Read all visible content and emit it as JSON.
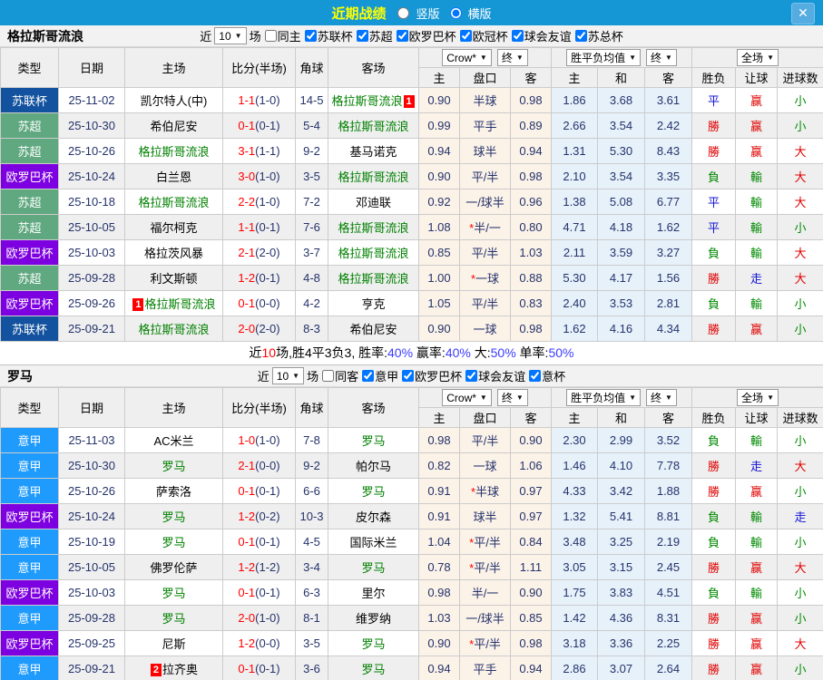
{
  "titlebar": {
    "title": "近期战绩",
    "radio_vertical": "竖版",
    "radio_horizontal": "横版",
    "selected": "横版",
    "close": "✕"
  },
  "colors": {
    "bar": "#1697d5",
    "league": {
      "苏联杯": "#13529e",
      "苏超": "#5fa880",
      "欧罗巴杯": "#7d00e0",
      "意甲": "#1e9bfc"
    },
    "result": {
      "r": "#e00000",
      "g": "#018a01",
      "b": "#1414d4"
    },
    "score": "#ff0000",
    "half": "#25336b",
    "team_highlight": "#008000",
    "badge": "#ff0000"
  },
  "table_header": {
    "type": "类型",
    "date": "日期",
    "home": "主场",
    "score": "比分(半场)",
    "corner": "角球",
    "away": "客场",
    "sub": [
      "主",
      "盘口",
      "客",
      "主",
      "和",
      "客",
      "胜负",
      "让球",
      "进球数"
    ],
    "dropdowns": {
      "company": "Crow*",
      "final1": "终",
      "avg": "胜平负均值",
      "final2": "终",
      "scope": "全场"
    }
  },
  "sections": [
    {
      "team": "格拉斯哥流浪",
      "filters": {
        "near": "近",
        "count": "10",
        "games": "场",
        "same": "同主",
        "same_checked": false,
        "leagues": [
          "苏联杯",
          "苏超",
          "欧罗巴杯",
          "欧冠杯",
          "球会友谊",
          "苏总杯"
        ]
      },
      "rows": [
        {
          "lg": "苏联杯",
          "date": "25-11-02",
          "home": "凯尔特人(中)",
          "hbadge": "",
          "hteam": false,
          "ft": "1-1",
          "half": "(1-0)",
          "corner": "14-5",
          "away": "格拉斯哥流浪",
          "abadge": "1",
          "ateam": true,
          "ah": [
            "0.90",
            "半球",
            "0.98"
          ],
          "eu": [
            "1.86",
            "3.68",
            "3.61"
          ],
          "res": [
            [
              "平",
              "b"
            ],
            [
              "赢",
              "r"
            ],
            [
              "小",
              "g"
            ]
          ]
        },
        {
          "lg": "苏超",
          "date": "25-10-30",
          "home": "希伯尼安",
          "hbadge": "",
          "hteam": false,
          "ft": "0-1",
          "half": "(0-1)",
          "corner": "5-4",
          "away": "格拉斯哥流浪",
          "abadge": "",
          "ateam": true,
          "ah": [
            "0.99",
            "平手",
            "0.89"
          ],
          "eu": [
            "2.66",
            "3.54",
            "2.42"
          ],
          "res": [
            [
              "勝",
              "r"
            ],
            [
              "赢",
              "r"
            ],
            [
              "小",
              "g"
            ]
          ]
        },
        {
          "lg": "苏超",
          "date": "25-10-26",
          "home": "格拉斯哥流浪",
          "hbadge": "",
          "hteam": true,
          "ft": "3-1",
          "half": "(1-1)",
          "corner": "9-2",
          "away": "基马诺克",
          "abadge": "",
          "ateam": false,
          "ah": [
            "0.94",
            "球半",
            "0.94"
          ],
          "eu": [
            "1.31",
            "5.30",
            "8.43"
          ],
          "res": [
            [
              "勝",
              "r"
            ],
            [
              "赢",
              "r"
            ],
            [
              "大",
              "r"
            ]
          ]
        },
        {
          "lg": "欧罗巴杯",
          "date": "25-10-24",
          "home": "白兰恩",
          "hbadge": "",
          "hteam": false,
          "ft": "3-0",
          "half": "(1-0)",
          "corner": "3-5",
          "away": "格拉斯哥流浪",
          "abadge": "",
          "ateam": true,
          "ah": [
            "0.90",
            "平/半",
            "0.98"
          ],
          "eu": [
            "2.10",
            "3.54",
            "3.35"
          ],
          "res": [
            [
              "負",
              "g"
            ],
            [
              "輸",
              "g"
            ],
            [
              "大",
              "r"
            ]
          ]
        },
        {
          "lg": "苏超",
          "date": "25-10-18",
          "home": "格拉斯哥流浪",
          "hbadge": "",
          "hteam": true,
          "ft": "2-2",
          "half": "(1-0)",
          "corner": "7-2",
          "away": "邓迪联",
          "abadge": "",
          "ateam": false,
          "ah": [
            "0.92",
            "一/球半",
            "0.96"
          ],
          "eu": [
            "1.38",
            "5.08",
            "6.77"
          ],
          "res": [
            [
              "平",
              "b"
            ],
            [
              "輸",
              "g"
            ],
            [
              "大",
              "r"
            ]
          ]
        },
        {
          "lg": "苏超",
          "date": "25-10-05",
          "home": "福尔柯克",
          "hbadge": "",
          "hteam": false,
          "ft": "1-1",
          "half": "(0-1)",
          "corner": "7-6",
          "away": "格拉斯哥流浪",
          "abadge": "",
          "ateam": true,
          "ah": [
            "1.08",
            "*半/一",
            "0.80"
          ],
          "eu": [
            "4.71",
            "4.18",
            "1.62"
          ],
          "res": [
            [
              "平",
              "b"
            ],
            [
              "輸",
              "g"
            ],
            [
              "小",
              "g"
            ]
          ]
        },
        {
          "lg": "欧罗巴杯",
          "date": "25-10-03",
          "home": "格拉茨风暴",
          "hbadge": "",
          "hteam": false,
          "ft": "2-1",
          "half": "(2-0)",
          "corner": "3-7",
          "away": "格拉斯哥流浪",
          "abadge": "",
          "ateam": true,
          "ah": [
            "0.85",
            "平/半",
            "1.03"
          ],
          "eu": [
            "2.11",
            "3.59",
            "3.27"
          ],
          "res": [
            [
              "負",
              "g"
            ],
            [
              "輸",
              "g"
            ],
            [
              "大",
              "r"
            ]
          ]
        },
        {
          "lg": "苏超",
          "date": "25-09-28",
          "home": "利文斯顿",
          "hbadge": "",
          "hteam": false,
          "ft": "1-2",
          "half": "(0-1)",
          "corner": "4-8",
          "away": "格拉斯哥流浪",
          "abadge": "",
          "ateam": true,
          "ah": [
            "1.00",
            "*一球",
            "0.88"
          ],
          "eu": [
            "5.30",
            "4.17",
            "1.56"
          ],
          "res": [
            [
              "勝",
              "r"
            ],
            [
              "走",
              "b"
            ],
            [
              "大",
              "r"
            ]
          ]
        },
        {
          "lg": "欧罗巴杯",
          "date": "25-09-26",
          "home": "格拉斯哥流浪",
          "hbadge": "1",
          "hteam": true,
          "ft": "0-1",
          "half": "(0-0)",
          "corner": "4-2",
          "away": "亨克",
          "abadge": "",
          "ateam": false,
          "ah": [
            "1.05",
            "平/半",
            "0.83"
          ],
          "eu": [
            "2.40",
            "3.53",
            "2.81"
          ],
          "res": [
            [
              "負",
              "g"
            ],
            [
              "輸",
              "g"
            ],
            [
              "小",
              "g"
            ]
          ]
        },
        {
          "lg": "苏联杯",
          "date": "25-09-21",
          "home": "格拉斯哥流浪",
          "hbadge": "",
          "hteam": true,
          "ft": "2-0",
          "half": "(2-0)",
          "corner": "8-3",
          "away": "希伯尼安",
          "abadge": "",
          "ateam": false,
          "ah": [
            "0.90",
            "一球",
            "0.98"
          ],
          "eu": [
            "1.62",
            "4.16",
            "4.34"
          ],
          "res": [
            [
              "勝",
              "r"
            ],
            [
              "赢",
              "r"
            ],
            [
              "小",
              "g"
            ]
          ]
        }
      ],
      "summary": [
        [
          "近",
          "k"
        ],
        [
          "10",
          "r"
        ],
        [
          "场,胜4平3负3, 胜率:",
          "k"
        ],
        [
          "40%",
          "b"
        ],
        [
          " 赢率:",
          "k"
        ],
        [
          "40%",
          "b"
        ],
        [
          " 大:",
          "k"
        ],
        [
          "50%",
          "b"
        ],
        [
          " 单率:",
          "k"
        ],
        [
          "50%",
          "b"
        ]
      ]
    },
    {
      "team": "罗马",
      "filters": {
        "near": "近",
        "count": "10",
        "games": "场",
        "same": "同客",
        "same_checked": false,
        "leagues": [
          "意甲",
          "欧罗巴杯",
          "球会友谊",
          "意杯"
        ]
      },
      "rows": [
        {
          "lg": "意甲",
          "date": "25-11-03",
          "home": "AC米兰",
          "hbadge": "",
          "hteam": false,
          "ft": "1-0",
          "half": "(1-0)",
          "corner": "7-8",
          "away": "罗马",
          "abadge": "",
          "ateam": true,
          "ah": [
            "0.98",
            "平/半",
            "0.90"
          ],
          "eu": [
            "2.30",
            "2.99",
            "3.52"
          ],
          "res": [
            [
              "負",
              "g"
            ],
            [
              "輸",
              "g"
            ],
            [
              "小",
              "g"
            ]
          ]
        },
        {
          "lg": "意甲",
          "date": "25-10-30",
          "home": "罗马",
          "hbadge": "",
          "hteam": true,
          "ft": "2-1",
          "half": "(0-0)",
          "corner": "9-2",
          "away": "帕尔马",
          "abadge": "",
          "ateam": false,
          "ah": [
            "0.82",
            "一球",
            "1.06"
          ],
          "eu": [
            "1.46",
            "4.10",
            "7.78"
          ],
          "res": [
            [
              "勝",
              "r"
            ],
            [
              "走",
              "b"
            ],
            [
              "大",
              "r"
            ]
          ]
        },
        {
          "lg": "意甲",
          "date": "25-10-26",
          "home": "萨索洛",
          "hbadge": "",
          "hteam": false,
          "ft": "0-1",
          "half": "(0-1)",
          "corner": "6-6",
          "away": "罗马",
          "abadge": "",
          "ateam": true,
          "ah": [
            "0.91",
            "*半球",
            "0.97"
          ],
          "eu": [
            "4.33",
            "3.42",
            "1.88"
          ],
          "res": [
            [
              "勝",
              "r"
            ],
            [
              "赢",
              "r"
            ],
            [
              "小",
              "g"
            ]
          ]
        },
        {
          "lg": "欧罗巴杯",
          "date": "25-10-24",
          "home": "罗马",
          "hbadge": "",
          "hteam": true,
          "ft": "1-2",
          "half": "(0-2)",
          "corner": "10-3",
          "away": "皮尔森",
          "abadge": "",
          "ateam": false,
          "ah": [
            "0.91",
            "球半",
            "0.97"
          ],
          "eu": [
            "1.32",
            "5.41",
            "8.81"
          ],
          "res": [
            [
              "負",
              "g"
            ],
            [
              "輸",
              "g"
            ],
            [
              "走",
              "b"
            ]
          ]
        },
        {
          "lg": "意甲",
          "date": "25-10-19",
          "home": "罗马",
          "hbadge": "",
          "hteam": true,
          "ft": "0-1",
          "half": "(0-1)",
          "corner": "4-5",
          "away": "国际米兰",
          "abadge": "",
          "ateam": false,
          "ah": [
            "1.04",
            "*平/半",
            "0.84"
          ],
          "eu": [
            "3.48",
            "3.25",
            "2.19"
          ],
          "res": [
            [
              "負",
              "g"
            ],
            [
              "輸",
              "g"
            ],
            [
              "小",
              "g"
            ]
          ]
        },
        {
          "lg": "意甲",
          "date": "25-10-05",
          "home": "佛罗伦萨",
          "hbadge": "",
          "hteam": false,
          "ft": "1-2",
          "half": "(1-2)",
          "corner": "3-4",
          "away": "罗马",
          "abadge": "",
          "ateam": true,
          "ah": [
            "0.78",
            "*平/半",
            "1.11"
          ],
          "eu": [
            "3.05",
            "3.15",
            "2.45"
          ],
          "res": [
            [
              "勝",
              "r"
            ],
            [
              "赢",
              "r"
            ],
            [
              "大",
              "r"
            ]
          ]
        },
        {
          "lg": "欧罗巴杯",
          "date": "25-10-03",
          "home": "罗马",
          "hbadge": "",
          "hteam": true,
          "ft": "0-1",
          "half": "(0-1)",
          "corner": "6-3",
          "away": "里尔",
          "abadge": "",
          "ateam": false,
          "ah": [
            "0.98",
            "半/一",
            "0.90"
          ],
          "eu": [
            "1.75",
            "3.83",
            "4.51"
          ],
          "res": [
            [
              "負",
              "g"
            ],
            [
              "輸",
              "g"
            ],
            [
              "小",
              "g"
            ]
          ]
        },
        {
          "lg": "意甲",
          "date": "25-09-28",
          "home": "罗马",
          "hbadge": "",
          "hteam": true,
          "ft": "2-0",
          "half": "(1-0)",
          "corner": "8-1",
          "away": "维罗纳",
          "abadge": "",
          "ateam": false,
          "ah": [
            "1.03",
            "一/球半",
            "0.85"
          ],
          "eu": [
            "1.42",
            "4.36",
            "8.31"
          ],
          "res": [
            [
              "勝",
              "r"
            ],
            [
              "赢",
              "r"
            ],
            [
              "小",
              "g"
            ]
          ]
        },
        {
          "lg": "欧罗巴杯",
          "date": "25-09-25",
          "home": "尼斯",
          "hbadge": "",
          "hteam": false,
          "ft": "1-2",
          "half": "(0-0)",
          "corner": "3-5",
          "away": "罗马",
          "abadge": "",
          "ateam": true,
          "ah": [
            "0.90",
            "*平/半",
            "0.98"
          ],
          "eu": [
            "3.18",
            "3.36",
            "2.25"
          ],
          "res": [
            [
              "勝",
              "r"
            ],
            [
              "赢",
              "r"
            ],
            [
              "大",
              "r"
            ]
          ]
        },
        {
          "lg": "意甲",
          "date": "25-09-21",
          "home": "拉齐奥",
          "hbadge": "2",
          "hteam": false,
          "ft": "0-1",
          "half": "(0-1)",
          "corner": "3-6",
          "away": "罗马",
          "abadge": "",
          "ateam": true,
          "ah": [
            "0.94",
            "平手",
            "0.94"
          ],
          "eu": [
            "2.86",
            "3.07",
            "2.64"
          ],
          "res": [
            [
              "勝",
              "r"
            ],
            [
              "赢",
              "r"
            ],
            [
              "小",
              "g"
            ]
          ]
        }
      ],
      "summary": null
    }
  ]
}
